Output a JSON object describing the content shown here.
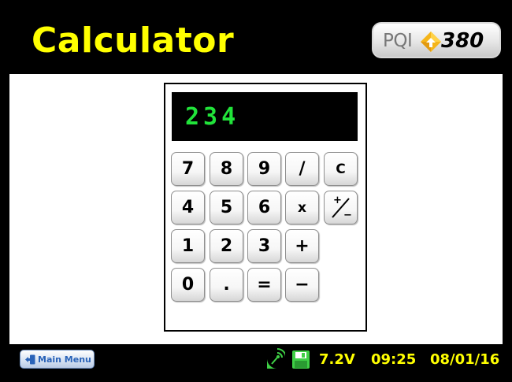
{
  "header": {
    "title": "Calculator",
    "logo": {
      "text": "PQI",
      "model": "380"
    }
  },
  "calculator": {
    "display_value": "234",
    "keys": {
      "k7": "7",
      "k8": "8",
      "k9": "9",
      "divide": "/",
      "clear": "C",
      "k4": "4",
      "k5": "5",
      "k6": "6",
      "multiply": "x",
      "k1": "1",
      "k2": "2",
      "k3": "3",
      "plus": "+",
      "k0": "0",
      "dot": ".",
      "equals": "=",
      "minus": "−"
    },
    "plus_minus": {
      "plus": "+",
      "minus": "−"
    }
  },
  "footer": {
    "main_menu_label": "Main Menu",
    "battery_voltage": "7.2V",
    "time": "09:25",
    "date": "08/01/16"
  },
  "colors": {
    "title": "#ffff00",
    "display_text": "#21e33a",
    "status_text": "#ffff00",
    "disk_icon": "#3fd046"
  },
  "icons": [
    "exit-door-icon",
    "satellite-icon",
    "floppy-disk-icon",
    "logo-arrow-icon"
  ]
}
